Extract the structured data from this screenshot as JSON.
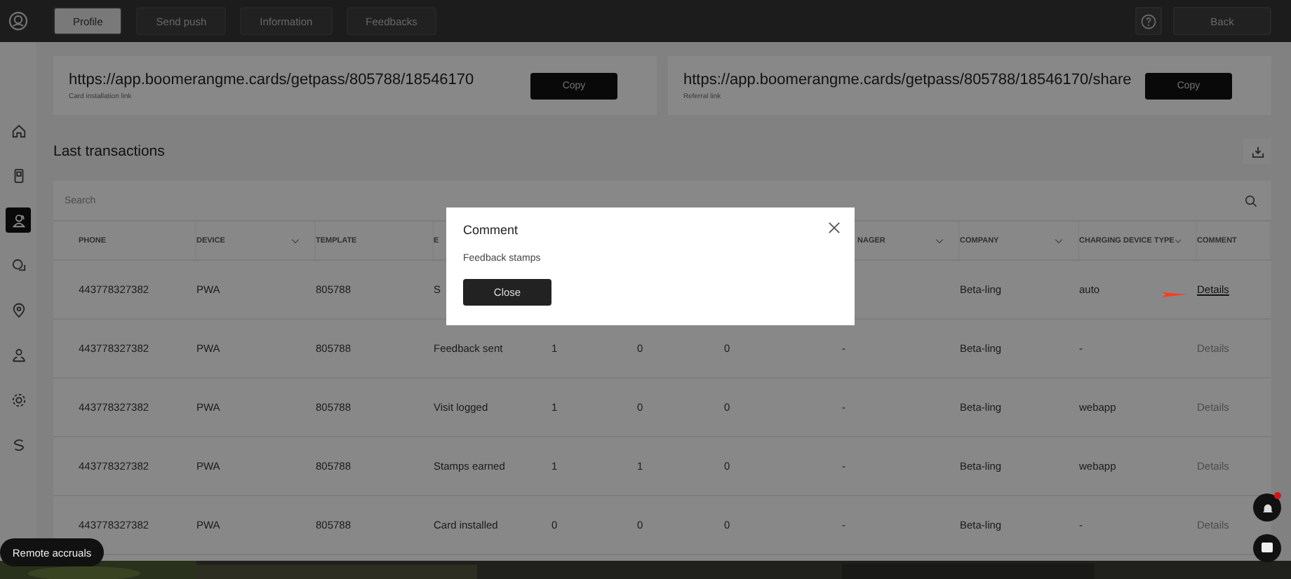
{
  "topbar": {
    "tabs": [
      {
        "label": "Profile",
        "selected": true
      },
      {
        "label": "Send push",
        "selected": false
      },
      {
        "label": "Information",
        "selected": false
      },
      {
        "label": "Feedbacks",
        "selected": false
      }
    ],
    "back_button": "Back"
  },
  "sidebar": {
    "items": [
      {
        "kind": "home",
        "selected": false
      },
      {
        "kind": "card",
        "selected": false
      },
      {
        "kind": "users",
        "selected": true
      },
      {
        "kind": "chat",
        "selected": false
      },
      {
        "kind": "pin",
        "selected": false
      },
      {
        "kind": "people",
        "selected": false
      },
      {
        "kind": "gear",
        "selected": false
      },
      {
        "kind": "dollar",
        "selected": false
      }
    ]
  },
  "links": [
    {
      "url": "https://app.boomerangme.cards/getpass/805788/18546170",
      "caption": "Card installation link",
      "button": "Copy"
    },
    {
      "url": "https://app.boomerangme.cards/getpass/805788/18546170/share",
      "caption": "Referral link",
      "button": "Copy"
    }
  ],
  "transactions": {
    "title": "Last transactions",
    "search": {
      "placeholder": "Search"
    },
    "columns": [
      {
        "label": "PHONE",
        "sortable": false
      },
      {
        "label": "DEVICE",
        "sortable": true
      },
      {
        "label": "TEMPLATE",
        "sortable": false
      },
      {
        "label": "E",
        "sortable": false
      },
      null,
      null,
      null,
      {
        "label": "NAGER",
        "sortable": true
      },
      {
        "label": "COMPANY",
        "sortable": true
      },
      {
        "label": "CHARGING DEVICE TYPE",
        "sortable": true
      },
      {
        "label": "COMMENT",
        "sortable": false
      }
    ],
    "rows": [
      {
        "cells": [
          "443778327382",
          "PWA",
          "805788",
          "S",
          null,
          null,
          null,
          null,
          "Beta-ling",
          "auto"
        ],
        "comment": {
          "label": "Details",
          "disabled": false
        }
      },
      {
        "cells": [
          "443778327382",
          "PWA",
          "805788",
          "Feedback sent",
          "1",
          "0",
          "0",
          "-",
          "Beta-ling",
          "-"
        ],
        "comment": {
          "label": "Details",
          "disabled": true
        }
      },
      {
        "cells": [
          "443778327382",
          "PWA",
          "805788",
          "Visit logged",
          "1",
          "0",
          "0",
          "-",
          "Beta-ling",
          "webapp"
        ],
        "comment": {
          "label": "Details",
          "disabled": true
        }
      },
      {
        "cells": [
          "443778327382",
          "PWA",
          "805788",
          "Stamps earned",
          "1",
          "1",
          "0",
          "-",
          "Beta-ling",
          "webapp"
        ],
        "comment": {
          "label": "Details",
          "disabled": true
        }
      },
      {
        "cells": [
          "443778327382",
          "PWA",
          "805788",
          "Card installed",
          "0",
          "0",
          "0",
          "-",
          "Beta-ling",
          "-"
        ],
        "comment": {
          "label": "Details",
          "disabled": true
        }
      }
    ]
  },
  "modal": {
    "title": "Comment",
    "text": "Feedback stamps",
    "button": "Close"
  },
  "remote_accruals_button": "Remote accruals"
}
